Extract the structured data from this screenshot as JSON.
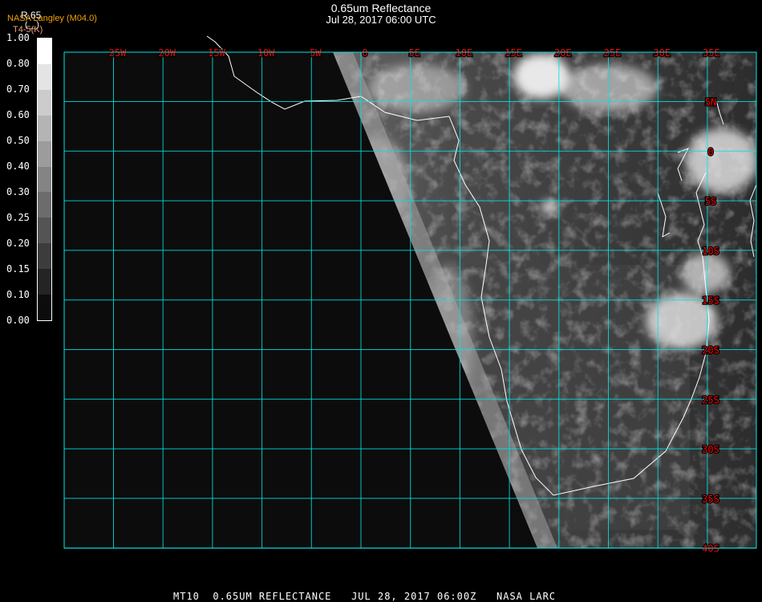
{
  "header": {
    "title": "0.65um Reflectance",
    "subtitle": "Jul 28, 2017 06:00 UTC",
    "product_label": "R.65",
    "source_label": "NASA Langley (M04.0)",
    "secondary_label": "T4-5(K)",
    "paren_label": "( _ )"
  },
  "colorbar": {
    "labels": [
      "1.00",
      "0.80",
      "0.70",
      "0.60",
      "0.50",
      "0.40",
      "0.30",
      "0.25",
      "0.20",
      "0.15",
      "0.10",
      "0.00"
    ],
    "colors": [
      "#ffffff",
      "#e4e4e4",
      "#cccccc",
      "#b4b4b4",
      "#9c9c9c",
      "#848484",
      "#6c6c6c",
      "#545454",
      "#3c3c3c",
      "#242424",
      "#0c0c0c"
    ]
  },
  "map": {
    "longitude_labels": [
      "25W",
      "20W",
      "15W",
      "10W",
      "5W",
      "0",
      "5E",
      "10E",
      "15E",
      "20E",
      "25E",
      "30E",
      "35E"
    ],
    "latitude_labels": [
      "5N",
      "0",
      "5S",
      "10S",
      "15S",
      "20S",
      "25S",
      "30S",
      "35S",
      "40S"
    ],
    "grid_color": "#00e5e5",
    "label_color": "#ff0000"
  },
  "footer": {
    "text": "MT10  0.65UM REFLECTANCE   JUL 28, 2017 06:00Z   NASA LARC"
  }
}
